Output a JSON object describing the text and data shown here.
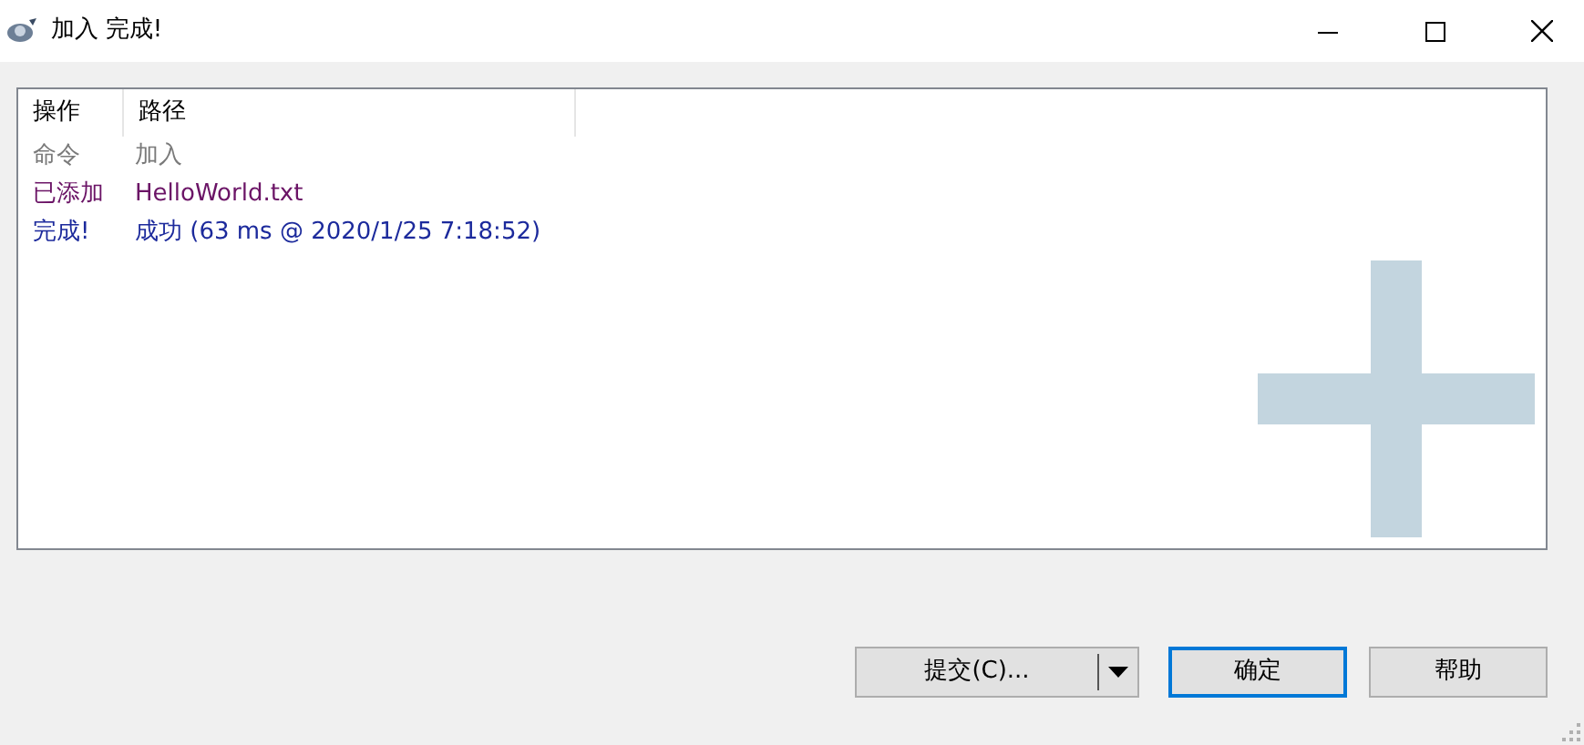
{
  "window": {
    "title": "加入 完成!"
  },
  "list": {
    "columns": [
      "操作",
      "路径"
    ],
    "rows": [
      {
        "action": "命令",
        "path": "加入",
        "color": "#7a7a7a"
      },
      {
        "action": "已添加",
        "path": "HelloWorld.txt",
        "color": "#6b1466"
      },
      {
        "action": "完成!",
        "path": "成功 (63 ms @ 2020/1/25 7:18:52)",
        "color": "#1c2a9c"
      }
    ]
  },
  "buttons": [
    {
      "kind": "split",
      "label": "提交(C)...",
      "focused": false
    },
    {
      "kind": "plain",
      "label": "确定",
      "focused": true
    },
    {
      "kind": "plain",
      "label": "帮助",
      "focused": false
    }
  ]
}
